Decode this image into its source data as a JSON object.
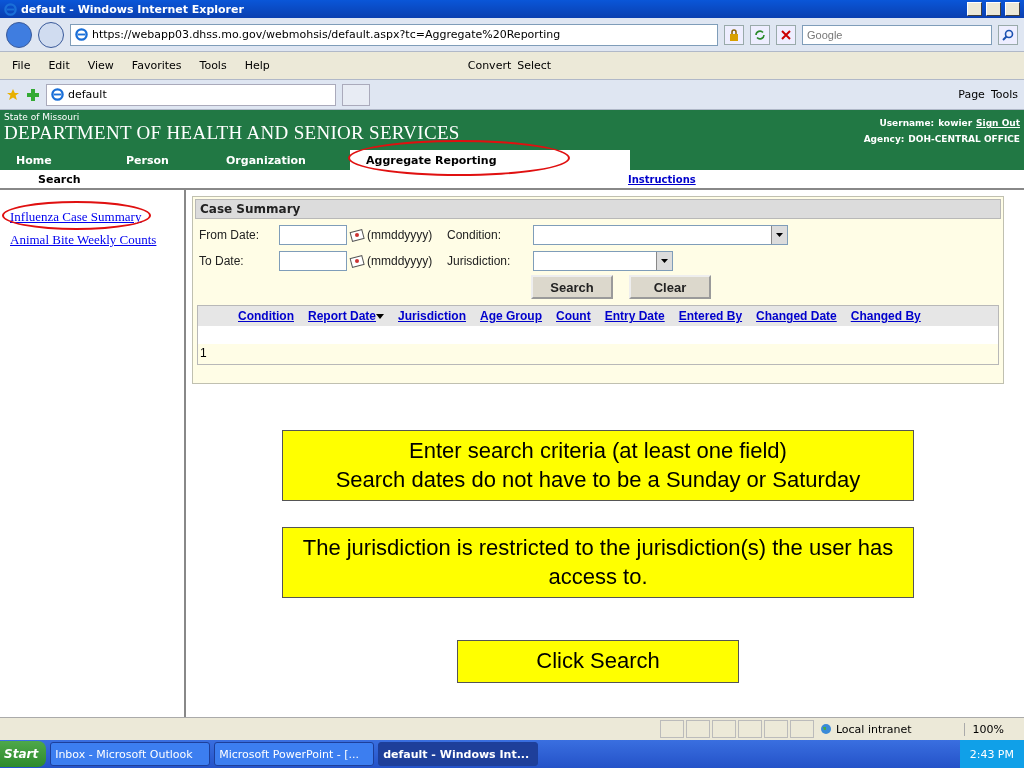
{
  "window": {
    "title": "default - Windows Internet Explorer"
  },
  "address_bar": {
    "url": "https://webapp03.dhss.mo.gov/webmohsis/default.aspx?tc=Aggregate%20Reporting",
    "search_placeholder": "Google"
  },
  "menu": [
    "File",
    "Edit",
    "View",
    "Favorites",
    "Tools",
    "Help"
  ],
  "toolbar_buttons": [
    "Convert",
    "Select"
  ],
  "favorites_tab": {
    "label": "default"
  },
  "command_bar": [
    "Page",
    "Tools"
  ],
  "header": {
    "state": "State of Missouri",
    "department": "DEPARTMENT OF HEALTH AND SENIOR SERVICES",
    "username_label": "Username:",
    "username": "kowier",
    "sign_out": "Sign Out",
    "agency_label": "Agency:",
    "agency": "DOH-CENTRAL OFFICE"
  },
  "nav_tabs": [
    {
      "label": "Home",
      "selected": false,
      "circled": false
    },
    {
      "label": "Person",
      "selected": false,
      "circled": false
    },
    {
      "label": "Organization",
      "selected": false,
      "circled": false
    },
    {
      "label": "Aggregate Reporting",
      "selected": true,
      "circled": true
    }
  ],
  "subnav": {
    "item": "Search",
    "link": "Instructions"
  },
  "sidebar": [
    {
      "label": "Influenza Case Summary",
      "circled": true
    },
    {
      "label": "Animal Bite Weekly Counts",
      "circled": false
    }
  ],
  "panel": {
    "title": "Case Summary",
    "from_label": "From Date:",
    "to_label": "To Date:",
    "date_hint": "(mmddyyyy)",
    "date_hint_2": "(mmddyyyy)",
    "condition_label": "Condition:",
    "jurisdiction_label": "Jurisdiction:",
    "buttons": [
      "Search",
      "Clear"
    ]
  },
  "table": {
    "columns": [
      {
        "label": "Condition",
        "sorted": false
      },
      {
        "label": "Report Date",
        "sorted": true
      },
      {
        "label": "Jurisdiction",
        "sorted": false
      },
      {
        "label": "Age Group",
        "sorted": false
      },
      {
        "label": "Count",
        "sorted": false
      },
      {
        "label": "Entry Date",
        "sorted": false
      },
      {
        "label": "Entered By",
        "sorted": false
      },
      {
        "label": "Changed Date",
        "sorted": false
      },
      {
        "label": "Changed By",
        "sorted": false
      }
    ],
    "pager": "1"
  },
  "callouts": [
    {
      "lines": [
        "Enter search criteria (at least one field)",
        "Search dates do not have to be a Sunday or Saturday"
      ]
    },
    {
      "lines": [
        "The jurisdiction is restricted to the jurisdiction(s) the user has access to."
      ]
    },
    {
      "lines": [
        "Click Search"
      ]
    }
  ],
  "status_bar": {
    "zone": "Local intranet",
    "zoom": "100%"
  },
  "taskbar": {
    "start": "Start",
    "tasks": [
      {
        "label": "Inbox - Microsoft Outlook",
        "selected": false
      },
      {
        "label": "Microsoft PowerPoint - [...",
        "selected": false
      },
      {
        "label": "default - Windows Int...",
        "selected": true
      }
    ],
    "time": "2:43 PM"
  }
}
